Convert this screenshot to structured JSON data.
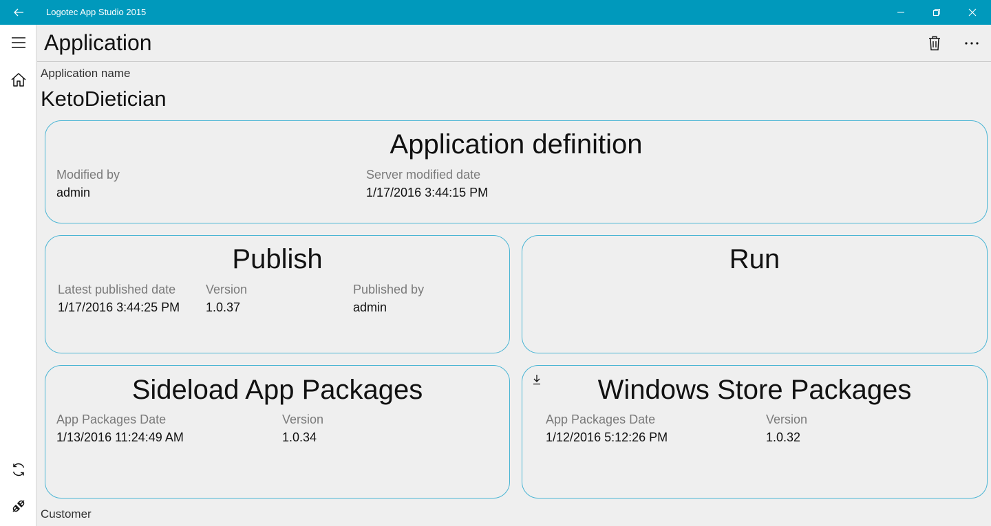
{
  "window": {
    "title": "Logotec App Studio 2015",
    "back_icon": "back-arrow-icon",
    "controls": [
      "minimize-icon",
      "restore-icon",
      "close-icon"
    ],
    "titlebar_color": "#0099bc"
  },
  "sidebar": {
    "top_items": [
      "hamburger-icon",
      "home-icon"
    ],
    "bottom_items": [
      "sync-icon",
      "connection-icon"
    ]
  },
  "header": {
    "title": "Application",
    "actions": [
      "delete-icon",
      "more-icon"
    ]
  },
  "app": {
    "name_label": "Application name",
    "name": "KetoDietician",
    "customer_label": "Customer"
  },
  "cards": {
    "definition": {
      "title": "Application definition",
      "modified_by_label": "Modified by",
      "modified_by": "admin",
      "server_date_label": "Server modified date",
      "server_date": "1/17/2016 3:44:15 PM"
    },
    "publish": {
      "title": "Publish",
      "date_label": "Latest published date",
      "date": "1/17/2016 3:44:25 PM",
      "version_label": "Version",
      "version": "1.0.37",
      "by_label": "Published by",
      "by": "admin"
    },
    "run": {
      "title": "Run"
    },
    "sideload": {
      "title": "Sideload App Packages",
      "date_label": "App Packages Date",
      "date": "1/13/2016 11:24:49 AM",
      "version_label": "Version",
      "version": "1.0.34"
    },
    "store": {
      "title": "Windows Store Packages",
      "icon": "download-icon",
      "date_label": "App Packages Date",
      "date": "1/12/2016 5:12:26 PM",
      "version_label": "Version",
      "version": "1.0.32"
    }
  },
  "colors": {
    "accent": "#0099bc",
    "card_border": "#4ab5d4",
    "background": "#efefef"
  }
}
